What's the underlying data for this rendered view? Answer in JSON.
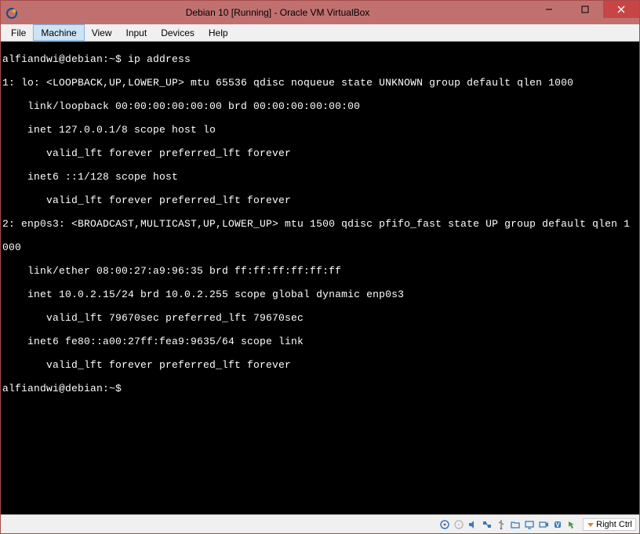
{
  "titlebar": {
    "title": "Debian 10 [Running] - Oracle VM VirtualBox"
  },
  "menubar": {
    "items": [
      {
        "label": "File",
        "active": false
      },
      {
        "label": "Machine",
        "active": true
      },
      {
        "label": "View",
        "active": false
      },
      {
        "label": "Input",
        "active": false
      },
      {
        "label": "Devices",
        "active": false
      },
      {
        "label": "Help",
        "active": false
      }
    ]
  },
  "terminal": {
    "lines": [
      "alfiandwi@debian:~$ ip address",
      "1: lo: <LOOPBACK,UP,LOWER_UP> mtu 65536 qdisc noqueue state UNKNOWN group default qlen 1000",
      "    link/loopback 00:00:00:00:00:00 brd 00:00:00:00:00:00",
      "    inet 127.0.0.1/8 scope host lo",
      "       valid_lft forever preferred_lft forever",
      "    inet6 ::1/128 scope host",
      "       valid_lft forever preferred_lft forever",
      "2: enp0s3: <BROADCAST,MULTICAST,UP,LOWER_UP> mtu 1500 qdisc pfifo_fast state UP group default qlen 1",
      "000",
      "    link/ether 08:00:27:a9:96:35 brd ff:ff:ff:ff:ff:ff",
      "    inet 10.0.2.15/24 brd 10.0.2.255 scope global dynamic enp0s3",
      "       valid_lft 79670sec preferred_lft 79670sec",
      "    inet6 fe80::a00:27ff:fea9:9635/64 scope link",
      "       valid_lft forever preferred_lft forever",
      "alfiandwi@debian:~$ "
    ]
  },
  "statusbar": {
    "host_key": "Right Ctrl"
  }
}
